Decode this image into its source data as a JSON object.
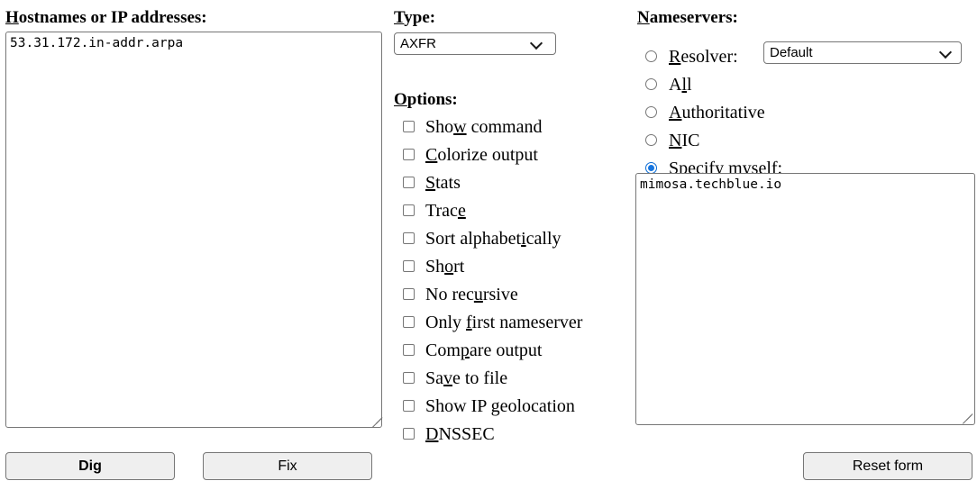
{
  "hostnames": {
    "label_prefix": "",
    "label_accesskey": "H",
    "label_suffix": "ostnames or IP addresses:",
    "value": "53.31.172.in-addr.arpa"
  },
  "type": {
    "label_accesskey": "T",
    "label_suffix": "ype:",
    "selected": "AXFR",
    "arrow_icon": "chevron-down-icon"
  },
  "options": {
    "label_accesskey": "O",
    "label_suffix": "ptions:",
    "items": [
      {
        "pre": "Sho",
        "ak": "w",
        "post": " command",
        "checked": false
      },
      {
        "pre": "",
        "ak": "C",
        "post": "olorize output",
        "checked": false
      },
      {
        "pre": "",
        "ak": "S",
        "post": "tats",
        "checked": false
      },
      {
        "pre": "Trac",
        "ak": "e",
        "post": "",
        "checked": false
      },
      {
        "pre": "Sort alphabet",
        "ak": "i",
        "post": "cally",
        "checked": false
      },
      {
        "pre": "Sh",
        "ak": "o",
        "post": "rt",
        "checked": false
      },
      {
        "pre": "No rec",
        "ak": "u",
        "post": "rsive",
        "checked": false
      },
      {
        "pre": "Only ",
        "ak": "f",
        "post": "irst nameserver",
        "checked": false
      },
      {
        "pre": "Com",
        "ak": "p",
        "post": "are output",
        "checked": false
      },
      {
        "pre": "Sa",
        "ak": "v",
        "post": "e to file",
        "checked": false
      },
      {
        "pre": "Show IP geolocation",
        "ak": "",
        "post": "",
        "checked": false
      },
      {
        "pre": "",
        "ak": "D",
        "post": "NSSEC",
        "checked": false
      }
    ]
  },
  "nameservers": {
    "label_accesskey": "N",
    "label_suffix": "ameservers:",
    "radios": [
      {
        "pre": "",
        "ak": "R",
        "post": "esolver:",
        "checked": false
      },
      {
        "pre": "A",
        "ak": "l",
        "post": "l",
        "checked": false
      },
      {
        "pre": "",
        "ak": "A",
        "post": "uthoritative",
        "checked": false
      },
      {
        "pre": "",
        "ak": "N",
        "post": "IC",
        "checked": false
      },
      {
        "pre": "Specify ",
        "ak": "m",
        "post": "yself:",
        "checked": true
      }
    ],
    "resolver": {
      "selected": "Default",
      "arrow_icon": "chevron-down-icon"
    },
    "value": "mimosa.techblue.io"
  },
  "buttons": {
    "dig": "Dig",
    "fix": "Fix",
    "reset": "Reset form"
  }
}
